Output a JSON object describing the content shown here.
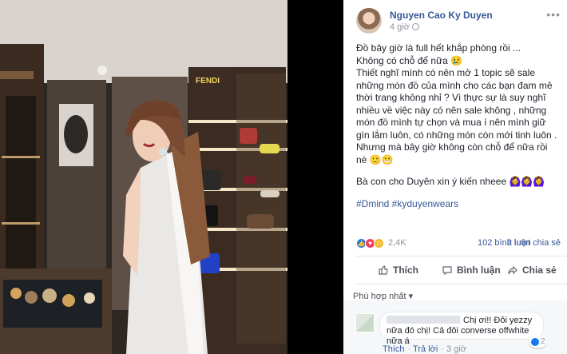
{
  "photo": {
    "shop_sign": "FENDI",
    "accent_colors": {
      "dress": "#e9e8e6",
      "wood": "#3a2b21",
      "shelf_glow": "#f6e5c7"
    }
  },
  "post": {
    "author": "Nguyen Cao Ky Duyen",
    "time": "4 giờ",
    "paragraphs": [
      "Đồ bây giờ là full hết khắp phòng rồi ...\nKhông có chỗ để nữa 😢\nThiết nghĩ mình có nên mở 1 topic sẽ sale những món đồ của mình cho các bạn đam mê thời trang không nhỉ ? Vì thực sự là suy nghĩ nhiều về việc này có nên sale không , những món đồ mình tự chọn và mua í nên mình giữ gìn lắm luôn, có những món còn mới tinh luôn . Nhưng mà bây giờ không còn chỗ để nữa rồi nè 🙂😬",
      "Bà con cho Duyên xin ý kiến nheee 🙆‍♀️🙆‍♀️🙆‍♀️",
      "#Dmind #kyduyenwears"
    ],
    "reactions": {
      "total": "2,4K",
      "comments": "102 bình luận",
      "shares": "2 lượt chia sẻ"
    },
    "actions": {
      "like": "Thích",
      "comment": "Bình luận",
      "share": "Chia sẻ"
    },
    "sort_label": "Phù hợp nhất ▾"
  },
  "comment": {
    "text": "Chị ơi!! Đôi yezzy nữa đó chị! Cả đôi converse offwhite nữa á",
    "like_action": "Thích",
    "reply_action": "Trả lời",
    "time": "3 giờ",
    "likes": "2"
  },
  "icons": [
    "more-icon",
    "globe-icon",
    "like-icon",
    "heart-icon",
    "haha-icon",
    "comment-icon",
    "share-icon"
  ]
}
